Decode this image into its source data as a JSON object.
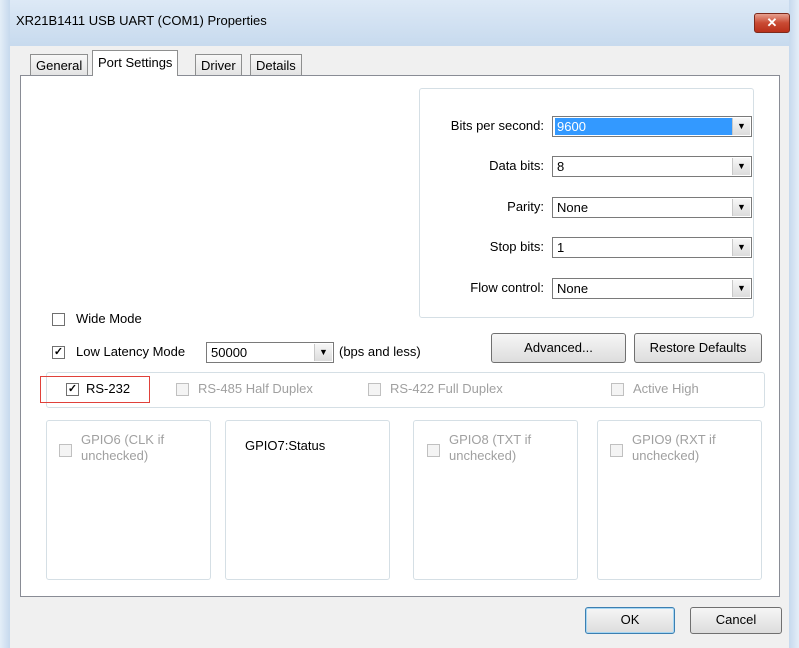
{
  "window": {
    "title": "XR21B1411 USB UART (COM1) Properties",
    "close_glyph": "✕"
  },
  "tabs": [
    {
      "label": "General",
      "active": false
    },
    {
      "label": "Port Settings",
      "active": true
    },
    {
      "label": "Driver",
      "active": false
    },
    {
      "label": "Details",
      "active": false
    }
  ],
  "port_settings": {
    "bits_per_second": {
      "label": "Bits per second:",
      "value": "9600"
    },
    "data_bits": {
      "label": "Data bits:",
      "value": "8"
    },
    "parity": {
      "label": "Parity:",
      "value": "None"
    },
    "stop_bits": {
      "label": "Stop bits:",
      "value": "1"
    },
    "flow_control": {
      "label": "Flow control:",
      "value": "None"
    }
  },
  "wide_mode": {
    "label": "Wide Mode",
    "checked": false
  },
  "low_latency": {
    "label": "Low Latency Mode",
    "checked": true,
    "value": "50000",
    "suffix": "(bps and less)"
  },
  "buttons": {
    "advanced": "Advanced...",
    "restore_defaults": "Restore Defaults",
    "ok": "OK",
    "cancel": "Cancel"
  },
  "modes": [
    {
      "label": "RS-232",
      "checked": true,
      "enabled": true
    },
    {
      "label": "RS-485 Half Duplex",
      "checked": false,
      "enabled": false
    },
    {
      "label": "RS-422 Full Duplex",
      "checked": false,
      "enabled": false
    },
    {
      "label": "Active High",
      "checked": false,
      "enabled": false
    }
  ],
  "gpio": {
    "gpio6": {
      "line1": "GPIO6 (CLK if",
      "line2": "unchecked)"
    },
    "gpio7": {
      "label": "GPIO7:Status"
    },
    "gpio8": {
      "line1": "GPIO8 (TXT if",
      "line2": "unchecked)"
    },
    "gpio9": {
      "line1": "GPIO9 (RXT if",
      "line2": "unchecked)"
    }
  },
  "glyphs": {
    "check": "✓",
    "dropdown": "▼"
  },
  "colors": {
    "highlight": "#3399ff",
    "annotation": "#e0413a",
    "close_button": "#c94a33"
  }
}
